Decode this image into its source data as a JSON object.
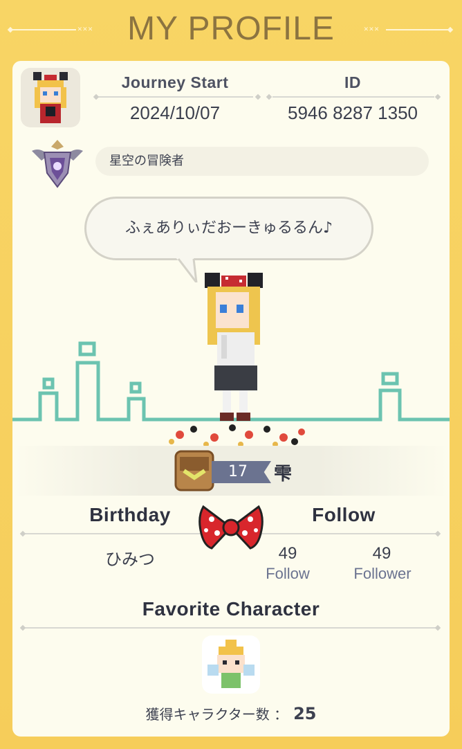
{
  "header": {
    "title": "MY PROFILE"
  },
  "profile": {
    "journey_label": "Journey Start",
    "journey_date": "2024/10/07",
    "id_label": "ID",
    "id_value": "5946 8287 1350",
    "title_name": "星空の冒険者",
    "greeting": "ふぇありぃだおーきゅるるん♪"
  },
  "level": {
    "value": "17",
    "name": "雫"
  },
  "birthday": {
    "label": "Birthday",
    "value": "ひみつ"
  },
  "follow": {
    "label": "Follow",
    "follow_count": "49",
    "follow_label": "Follow",
    "follower_count": "49",
    "follower_label": "Follower"
  },
  "favorite": {
    "label": "Favorite Character",
    "count_label": "獲得キャラクター数 ：",
    "count_value": "25"
  },
  "colors": {
    "frame": "#f6cf5e",
    "panel": "#fdfcee",
    "skyline": "#6cc3b0",
    "accent_text": "#2f3240",
    "level_tag": "#6b7390"
  }
}
